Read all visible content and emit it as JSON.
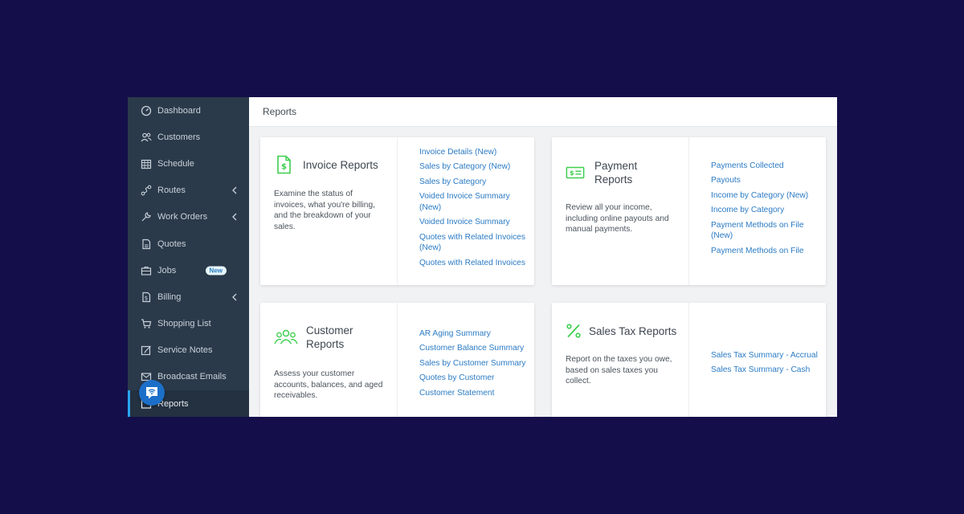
{
  "sidebar": {
    "items": [
      {
        "label": "Dashboard",
        "icon": "dashboard-icon"
      },
      {
        "label": "Customers",
        "icon": "customers-icon"
      },
      {
        "label": "Schedule",
        "icon": "calendar-icon"
      },
      {
        "label": "Routes",
        "icon": "routes-icon"
      },
      {
        "label": "Work Orders",
        "icon": "wrench-icon"
      },
      {
        "label": "Quotes",
        "icon": "quotes-icon"
      },
      {
        "label": "Jobs",
        "icon": "briefcase-icon",
        "badge": "New"
      },
      {
        "label": "Billing",
        "icon": "billing-icon"
      },
      {
        "label": "Shopping List",
        "icon": "cart-icon"
      },
      {
        "label": "Service Notes",
        "icon": "edit-icon"
      },
      {
        "label": "Broadcast Emails",
        "icon": "mail-icon"
      },
      {
        "label": "Reports",
        "icon": "reports-icon"
      }
    ]
  },
  "header": {
    "title": "Reports"
  },
  "cards": {
    "invoice": {
      "title": "Invoice Reports",
      "desc": "Examine the status of invoices, what you're billing, and the breakdown of your sales.",
      "links": [
        "Invoice Details (New)",
        "Sales by Category (New)",
        "Sales by Category",
        "Voided Invoice Summary (New)",
        "Voided Invoice Summary",
        "Quotes with Related Invoices (New)",
        "Quotes with Related Invoices"
      ]
    },
    "payment": {
      "title": "Payment Reports",
      "desc": "Review all your income, including online payouts and manual payments.",
      "links": [
        "Payments Collected",
        "Payouts",
        "Income by Category (New)",
        "Income by Category",
        "Payment Methods on File (New)",
        "Payment Methods on File"
      ]
    },
    "customer": {
      "title": "Customer Reports",
      "desc": "Assess your customer accounts, balances, and aged receivables.",
      "links": [
        "AR Aging Summary",
        "Customer Balance Summary",
        "Sales by Customer Summary",
        "Quotes by Customer",
        "Customer Statement"
      ]
    },
    "salestax": {
      "title": "Sales Tax Reports",
      "desc": "Report on the taxes you owe, based on sales taxes you collect.",
      "links": [
        "Sales Tax Summary - Accrual",
        "Sales Tax Summary - Cash"
      ]
    }
  },
  "colors": {
    "page_bg": "#140f4a",
    "sidebar_bg": "#2b3a4a",
    "accent_green": "#3ccf4e",
    "link_blue": "#2b7bc4",
    "active_indicator": "#2aa3ef"
  }
}
